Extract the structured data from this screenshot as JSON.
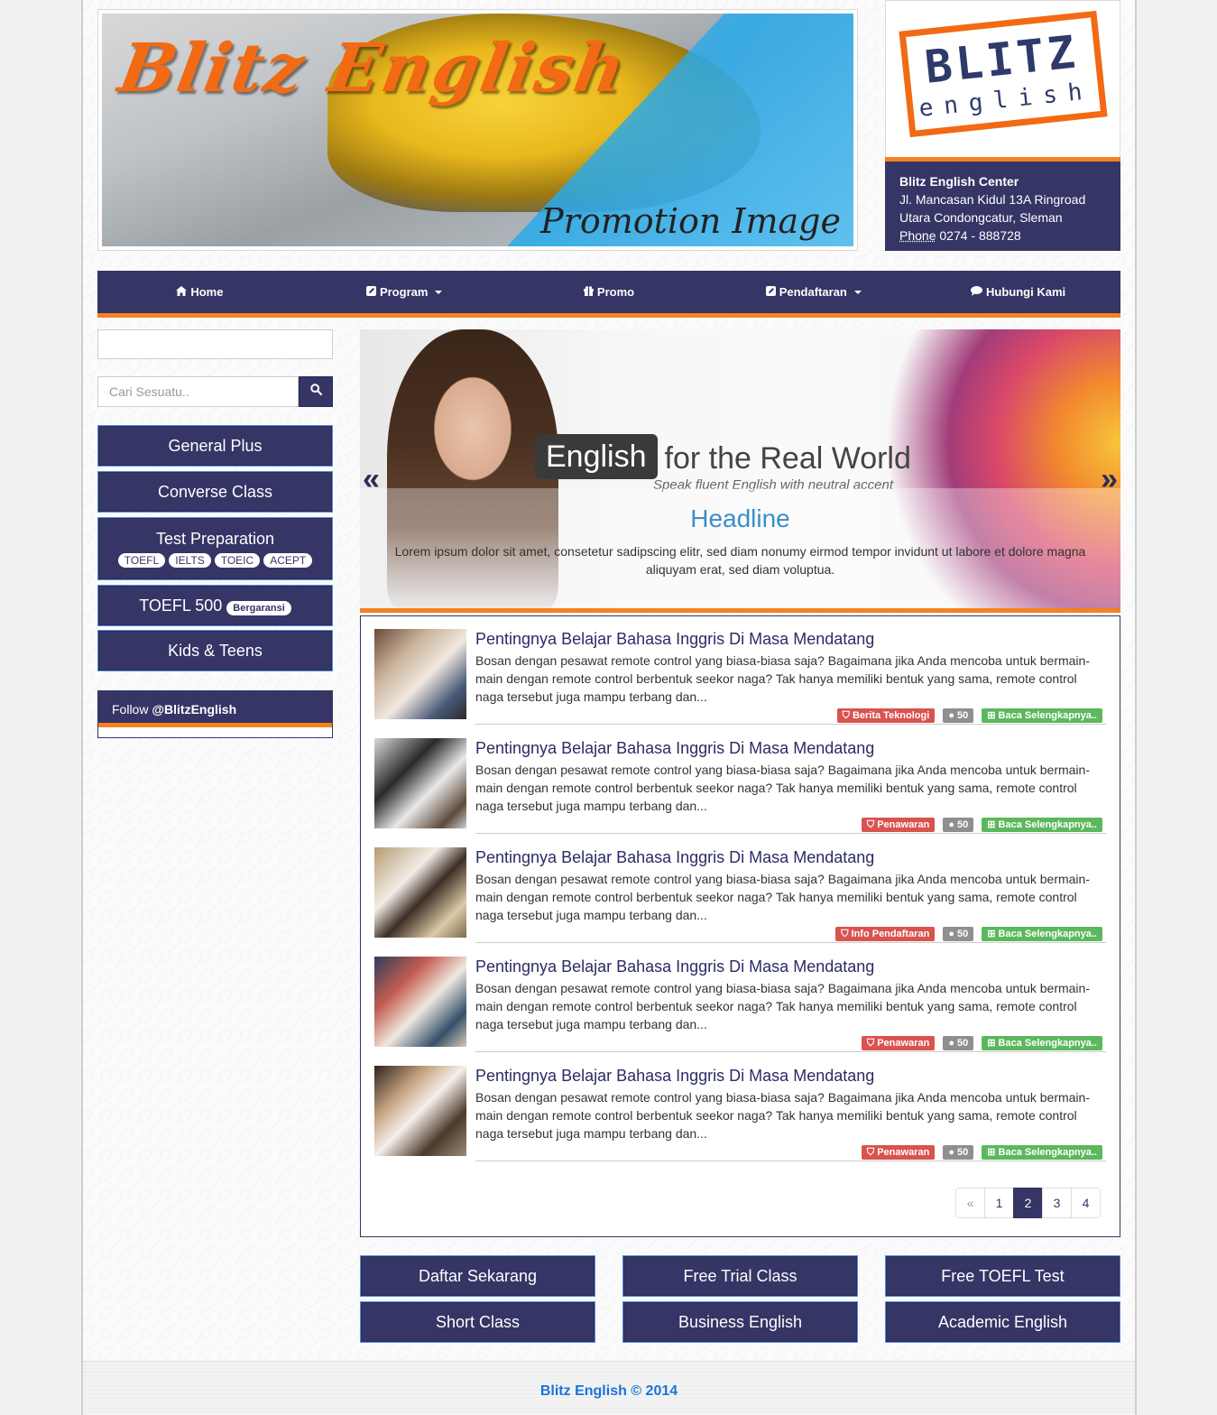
{
  "header": {
    "banner_title": "Blitz English",
    "banner_subtitle": "Promotion Image",
    "logo_top": "BLITZ",
    "logo_bottom": "english",
    "contact_name": "Blitz English Center",
    "contact_address_1": "Jl. Mancasan Kidul 13A Ringroad",
    "contact_address_2": "Utara Condongcatur, Sleman",
    "contact_phone_label": "Phone",
    "contact_phone": "0274 - 888728"
  },
  "nav": {
    "home": "Home",
    "program": "Program",
    "promo": "Promo",
    "pendaftaran": "Pendaftaran",
    "hubungi": "Hubungi Kami"
  },
  "sidebar": {
    "search_placeholder": "Cari Sesuatu..",
    "buttons": {
      "general_plus": "General Plus",
      "converse": "Converse Class",
      "test_prep": "Test Preparation",
      "test_tags": [
        "TOEFL",
        "IELTS",
        "TOEIC",
        "ACEPT"
      ],
      "toefl500": "TOEFL 500",
      "toefl500_badge": "Bergaransi",
      "kids": "Kids & Teens"
    },
    "follow_prefix": "Follow",
    "follow_handle": "@BlitzEnglish"
  },
  "slider": {
    "logo_dark": "English",
    "logo_light": "for the Real World",
    "tagline": "Speak fluent English with neutral accent",
    "headline": "Headline",
    "text": "Lorem ipsum dolor sit amet, consetetur sadipscing elitr, sed diam nonumy eirmod tempor invidunt ut labore et dolore magna aliquyam erat, sed diam voluptua.",
    "prev": "«",
    "next": "»"
  },
  "articles": [
    {
      "title": "Pentingnya Belajar Bahasa Inggris Di Masa Mendatang",
      "excerpt": "Bosan dengan pesawat remote control yang biasa-biasa saja? Bagaimana jika Anda mencoba untuk bermain-main dengan remote control berbentuk seekor naga? Tak hanya memiliki bentuk yang sama, remote control naga tersebut juga mampu terbang dan...",
      "category": "Berita Teknologi",
      "comments": "50",
      "read_more": "Baca Selengkapnya.."
    },
    {
      "title": "Pentingnya Belajar Bahasa Inggris Di Masa Mendatang",
      "excerpt": "Bosan dengan pesawat remote control yang biasa-biasa saja? Bagaimana jika Anda mencoba untuk bermain-main dengan remote control berbentuk seekor naga? Tak hanya memiliki bentuk yang sama, remote control naga tersebut juga mampu terbang dan...",
      "category": "Penawaran",
      "comments": "50",
      "read_more": "Baca Selengkapnya.."
    },
    {
      "title": "Pentingnya Belajar Bahasa Inggris Di Masa Mendatang",
      "excerpt": "Bosan dengan pesawat remote control yang biasa-biasa saja? Bagaimana jika Anda mencoba untuk bermain-main dengan remote control berbentuk seekor naga? Tak hanya memiliki bentuk yang sama, remote control naga tersebut juga mampu terbang dan...",
      "category": "Info Pendaftaran",
      "comments": "50",
      "read_more": "Baca Selengkapnya.."
    },
    {
      "title": "Pentingnya Belajar Bahasa Inggris Di Masa Mendatang",
      "excerpt": "Bosan dengan pesawat remote control yang biasa-biasa saja? Bagaimana jika Anda mencoba untuk bermain-main dengan remote control berbentuk seekor naga? Tak hanya memiliki bentuk yang sama, remote control naga tersebut juga mampu terbang dan...",
      "category": "Penawaran",
      "comments": "50",
      "read_more": "Baca Selengkapnya.."
    },
    {
      "title": "Pentingnya Belajar Bahasa Inggris Di Masa Mendatang",
      "excerpt": "Bosan dengan pesawat remote control yang biasa-biasa saja? Bagaimana jika Anda mencoba untuk bermain-main dengan remote control berbentuk seekor naga? Tak hanya memiliki bentuk yang sama, remote control naga tersebut juga mampu terbang dan...",
      "category": "Penawaran",
      "comments": "50",
      "read_more": "Baca Selengkapnya.."
    }
  ],
  "pagination": {
    "prev": "«",
    "pages": [
      "1",
      "2",
      "3",
      "4"
    ],
    "active": "2"
  },
  "cta": {
    "daftar": "Daftar Sekarang",
    "trial": "Free Trial Class",
    "toefl_test": "Free TOEFL Test",
    "short": "Short Class",
    "business": "Business English",
    "academic": "Academic English"
  },
  "footer": {
    "copyright": "Blitz English © 2014"
  },
  "colors": {
    "navy": "#353566",
    "orange": "#f5821f",
    "link_blue": "#1a73d9"
  }
}
